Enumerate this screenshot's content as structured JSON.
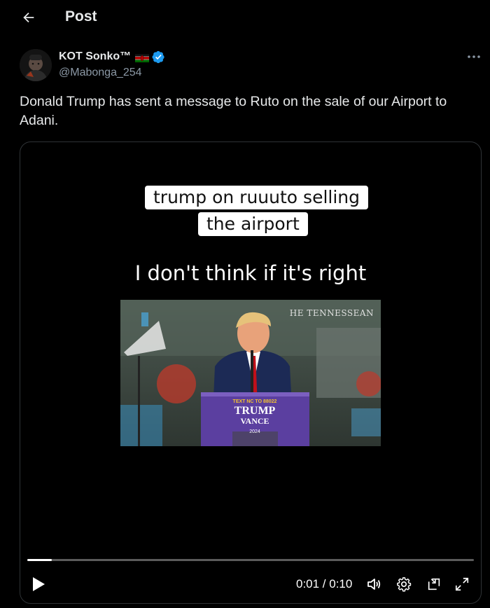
{
  "header": {
    "title": "Post",
    "back_icon": "arrow-left-icon"
  },
  "author": {
    "name": "KOT Sonko™",
    "flag_icon": "kenya-flag-icon",
    "verified_icon": "verified-badge-icon",
    "verified_color": "#1d9bf0",
    "handle": "@Mabonga_254"
  },
  "tweet": {
    "text": "Donald Trump has sent a message to Ruto on the sale of our Airport to Adani."
  },
  "video": {
    "caption_line1": "trump on ruuuto selling",
    "caption_line2": "the airport",
    "subtitle": "I don't think if it's right",
    "watermark": "HE TENNESSEAN",
    "podium_line1": "TEXT NC TO 88022",
    "podium_line2": "TRUMP",
    "podium_line3": "VANCE",
    "podium_line4": "2024",
    "progress": 0.055,
    "time_display": "0:01 / 0:10"
  },
  "controls": {
    "play_icon": "play-icon",
    "volume_icon": "volume-icon",
    "settings_icon": "gear-icon",
    "pip_icon": "picture-in-picture-icon",
    "fullscreen_icon": "fullscreen-icon"
  },
  "colors": {
    "background": "#000000",
    "text": "#e7e9ea",
    "muted": "#8b98a5",
    "border": "#2f3336"
  }
}
